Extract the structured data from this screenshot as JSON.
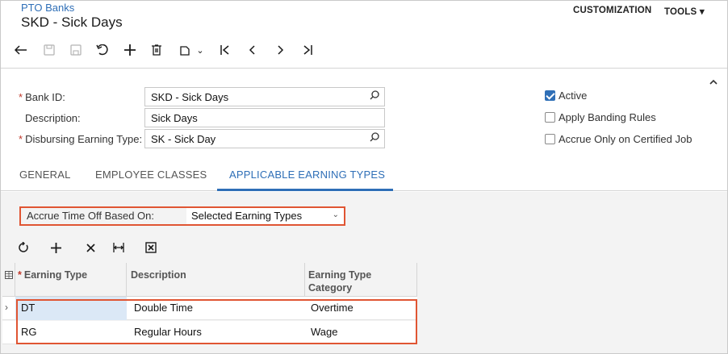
{
  "header": {
    "breadcrumb": "PTO Banks",
    "title": "SKD - Sick Days",
    "customization": "CUSTOMIZATION",
    "tools": "TOOLS"
  },
  "toolbar": {
    "back_icon": "back-arrow-icon",
    "save_close_icon": "save-close-icon",
    "save_icon": "save-icon",
    "undo_icon": "undo-icon",
    "add_icon": "add-icon",
    "delete_icon": "trash-icon",
    "copy_icon": "copy-paste-icon",
    "first_icon": "first-record-icon",
    "prev_icon": "previous-record-icon",
    "next_icon": "next-record-icon",
    "last_icon": "last-record-icon"
  },
  "form": {
    "bank_id_label": "Bank ID:",
    "bank_id_value": "SKD - Sick Days",
    "description_label": "Description:",
    "description_value": "Sick Days",
    "disbursing_label": "Disbursing Earning Type:",
    "disbursing_value": "SK - Sick Day",
    "active_label": "Active",
    "active_checked": true,
    "banding_label": "Apply Banding Rules",
    "banding_checked": false,
    "certified_label": "Accrue Only on Certified Job",
    "certified_checked": false
  },
  "tabs": [
    "GENERAL",
    "EMPLOYEE CLASSES",
    "APPLICABLE EARNING TYPES"
  ],
  "active_tab": "APPLICABLE EARNING TYPES",
  "accrue": {
    "label": "Accrue Time Off Based On:",
    "value": "Selected Earning Types"
  },
  "grid": {
    "columns": [
      "Earning Type",
      "Description",
      "Earning Type Category"
    ],
    "col3_line1": "Earning Type",
    "col3_line2": "Category",
    "rows": [
      {
        "type": "DT",
        "description": "Double Time",
        "category": "Overtime"
      },
      {
        "type": "RG",
        "description": "Regular Hours",
        "category": "Wage"
      }
    ]
  },
  "colors": {
    "accent": "#2f6fb7",
    "highlight_border": "#e05533"
  }
}
